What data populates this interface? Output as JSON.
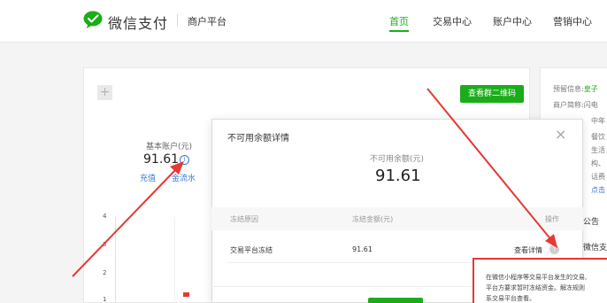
{
  "header": {
    "brand": "微信支付",
    "sub": "商户平台",
    "nav": [
      "首页",
      "交易中心",
      "账户中心",
      "营销中心"
    ],
    "active_nav": 0
  },
  "dashboard": {
    "plus": "+",
    "qr_button": "查看群二维码",
    "account_label": "基本账户(元)",
    "account_value": "91.61",
    "info_glyph": "i",
    "link_charge": "充值",
    "link_flow": "金流水",
    "y_ticks": [
      "4",
      "3",
      "2",
      "1"
    ]
  },
  "right_panel": {
    "lines": [
      {
        "label": "预留信息:",
        "value": "皇子"
      },
      {
        "label": "商户简称:",
        "value": "闪电"
      },
      {
        "label": "",
        "value": "中年"
      },
      {
        "label": "",
        "value": "餐饮"
      },
      {
        "label": "",
        "value": "生活"
      },
      {
        "label": "",
        "value": "构、"
      },
      {
        "label": "",
        "value": "话费"
      },
      {
        "label": "",
        "value": "点击"
      }
    ],
    "notice": "公告",
    "notice_item": "微信支付"
  },
  "modal": {
    "title": "不可用余额详情",
    "close": "×",
    "unavailable_label": "不可用余额(元)",
    "unavailable_value": "91.61",
    "columns": [
      "冻结原因",
      "冻结金额(元)",
      "操作"
    ],
    "row": {
      "reason": "交易平台冻结",
      "amount": "91.61",
      "action": "查看详情"
    },
    "help_glyph": "?"
  },
  "tooltip": {
    "lines": [
      "在微信小程序等交易平台发生的交易,",
      "平台方要求暂时冻结资金。解冻规则",
      "系交易平台查看。"
    ]
  },
  "colors": {
    "brand_green": "#1aad19",
    "link_blue": "#3a79d8",
    "annotation_red": "#e53935"
  }
}
